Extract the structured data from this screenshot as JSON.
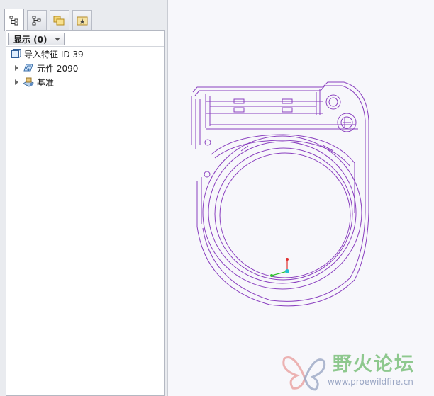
{
  "tabs": [
    {
      "icon": "model-tree-icon",
      "active": true
    },
    {
      "icon": "layer-tree-icon",
      "active": false
    },
    {
      "icon": "folder-browser-icon",
      "active": false
    },
    {
      "icon": "favorites-icon",
      "active": false
    }
  ],
  "tree": {
    "show_label": "显示 (0)",
    "items": [
      {
        "label": "导入特征 ID 39",
        "icon": "import-feature-icon",
        "expandable": false
      },
      {
        "label": "元件 2090",
        "icon": "component-icon",
        "expandable": true
      },
      {
        "label": "基准",
        "icon": "datum-icon",
        "expandable": true
      }
    ]
  },
  "watermark": {
    "title": "野火论坛",
    "url": "www.proewildfire.cn"
  },
  "colors": {
    "wireframe": "#8a3fbf",
    "axis_x": "#e03030",
    "axis_y": "#30c030",
    "axis_z": "#20c0d0"
  }
}
